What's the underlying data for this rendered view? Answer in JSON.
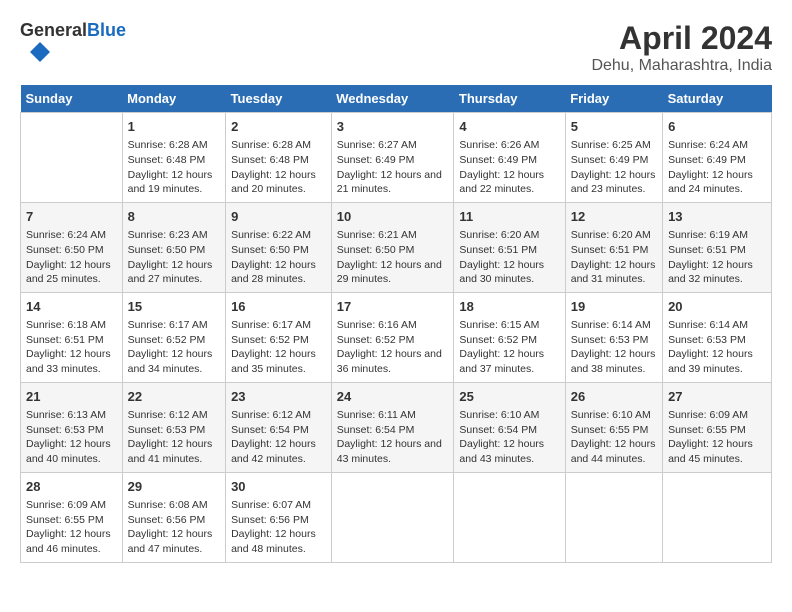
{
  "header": {
    "logo_line1": "General",
    "logo_line2": "Blue",
    "title": "April 2024",
    "subtitle": "Dehu, Maharashtra, India"
  },
  "calendar": {
    "days_of_week": [
      "Sunday",
      "Monday",
      "Tuesday",
      "Wednesday",
      "Thursday",
      "Friday",
      "Saturday"
    ],
    "weeks": [
      [
        {
          "day": "",
          "content": ""
        },
        {
          "day": "1",
          "content": "Sunrise: 6:28 AM\nSunset: 6:48 PM\nDaylight: 12 hours and 19 minutes."
        },
        {
          "day": "2",
          "content": "Sunrise: 6:28 AM\nSunset: 6:48 PM\nDaylight: 12 hours and 20 minutes."
        },
        {
          "day": "3",
          "content": "Sunrise: 6:27 AM\nSunset: 6:49 PM\nDaylight: 12 hours and 21 minutes."
        },
        {
          "day": "4",
          "content": "Sunrise: 6:26 AM\nSunset: 6:49 PM\nDaylight: 12 hours and 22 minutes."
        },
        {
          "day": "5",
          "content": "Sunrise: 6:25 AM\nSunset: 6:49 PM\nDaylight: 12 hours and 23 minutes."
        },
        {
          "day": "6",
          "content": "Sunrise: 6:24 AM\nSunset: 6:49 PM\nDaylight: 12 hours and 24 minutes."
        }
      ],
      [
        {
          "day": "7",
          "content": "Sunrise: 6:24 AM\nSunset: 6:50 PM\nDaylight: 12 hours and 25 minutes."
        },
        {
          "day": "8",
          "content": "Sunrise: 6:23 AM\nSunset: 6:50 PM\nDaylight: 12 hours and 27 minutes."
        },
        {
          "day": "9",
          "content": "Sunrise: 6:22 AM\nSunset: 6:50 PM\nDaylight: 12 hours and 28 minutes."
        },
        {
          "day": "10",
          "content": "Sunrise: 6:21 AM\nSunset: 6:50 PM\nDaylight: 12 hours and 29 minutes."
        },
        {
          "day": "11",
          "content": "Sunrise: 6:20 AM\nSunset: 6:51 PM\nDaylight: 12 hours and 30 minutes."
        },
        {
          "day": "12",
          "content": "Sunrise: 6:20 AM\nSunset: 6:51 PM\nDaylight: 12 hours and 31 minutes."
        },
        {
          "day": "13",
          "content": "Sunrise: 6:19 AM\nSunset: 6:51 PM\nDaylight: 12 hours and 32 minutes."
        }
      ],
      [
        {
          "day": "14",
          "content": "Sunrise: 6:18 AM\nSunset: 6:51 PM\nDaylight: 12 hours and 33 minutes."
        },
        {
          "day": "15",
          "content": "Sunrise: 6:17 AM\nSunset: 6:52 PM\nDaylight: 12 hours and 34 minutes."
        },
        {
          "day": "16",
          "content": "Sunrise: 6:17 AM\nSunset: 6:52 PM\nDaylight: 12 hours and 35 minutes."
        },
        {
          "day": "17",
          "content": "Sunrise: 6:16 AM\nSunset: 6:52 PM\nDaylight: 12 hours and 36 minutes."
        },
        {
          "day": "18",
          "content": "Sunrise: 6:15 AM\nSunset: 6:52 PM\nDaylight: 12 hours and 37 minutes."
        },
        {
          "day": "19",
          "content": "Sunrise: 6:14 AM\nSunset: 6:53 PM\nDaylight: 12 hours and 38 minutes."
        },
        {
          "day": "20",
          "content": "Sunrise: 6:14 AM\nSunset: 6:53 PM\nDaylight: 12 hours and 39 minutes."
        }
      ],
      [
        {
          "day": "21",
          "content": "Sunrise: 6:13 AM\nSunset: 6:53 PM\nDaylight: 12 hours and 40 minutes."
        },
        {
          "day": "22",
          "content": "Sunrise: 6:12 AM\nSunset: 6:53 PM\nDaylight: 12 hours and 41 minutes."
        },
        {
          "day": "23",
          "content": "Sunrise: 6:12 AM\nSunset: 6:54 PM\nDaylight: 12 hours and 42 minutes."
        },
        {
          "day": "24",
          "content": "Sunrise: 6:11 AM\nSunset: 6:54 PM\nDaylight: 12 hours and 43 minutes."
        },
        {
          "day": "25",
          "content": "Sunrise: 6:10 AM\nSunset: 6:54 PM\nDaylight: 12 hours and 43 minutes."
        },
        {
          "day": "26",
          "content": "Sunrise: 6:10 AM\nSunset: 6:55 PM\nDaylight: 12 hours and 44 minutes."
        },
        {
          "day": "27",
          "content": "Sunrise: 6:09 AM\nSunset: 6:55 PM\nDaylight: 12 hours and 45 minutes."
        }
      ],
      [
        {
          "day": "28",
          "content": "Sunrise: 6:09 AM\nSunset: 6:55 PM\nDaylight: 12 hours and 46 minutes."
        },
        {
          "day": "29",
          "content": "Sunrise: 6:08 AM\nSunset: 6:56 PM\nDaylight: 12 hours and 47 minutes."
        },
        {
          "day": "30",
          "content": "Sunrise: 6:07 AM\nSunset: 6:56 PM\nDaylight: 12 hours and 48 minutes."
        },
        {
          "day": "",
          "content": ""
        },
        {
          "day": "",
          "content": ""
        },
        {
          "day": "",
          "content": ""
        },
        {
          "day": "",
          "content": ""
        }
      ]
    ]
  }
}
